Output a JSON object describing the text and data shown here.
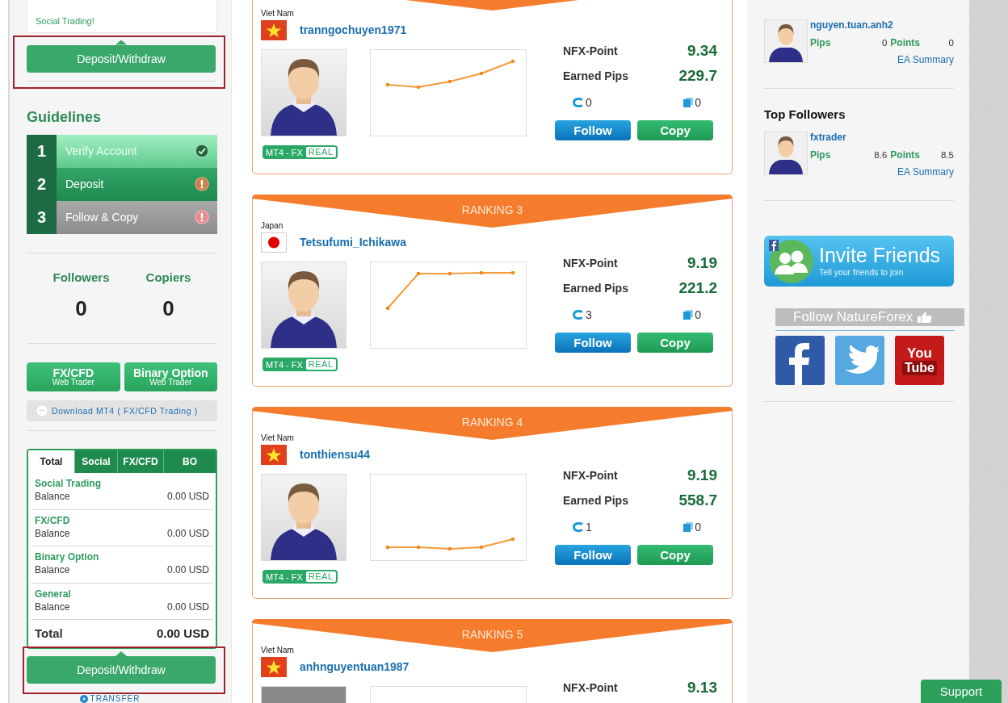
{
  "left_panel": {
    "intro_text": "Social Trading!",
    "top_deposit": {
      "label": "Deposit/Withdraw",
      "highlighted": true
    },
    "guidelines": {
      "title": "Guidelines",
      "steps": [
        {
          "number": "1",
          "label": "Verify Account",
          "kind": "done"
        },
        {
          "number": "2",
          "label": "Deposit",
          "kind": "current"
        },
        {
          "number": "3",
          "label": "Follow & Copy",
          "kind": "pending"
        }
      ]
    },
    "stats": [
      {
        "label": "Followers",
        "value": "0"
      },
      {
        "label": "Copiers",
        "value": "0"
      }
    ],
    "trader_buttons": [
      {
        "title": "FX/CFD",
        "subtitle": "Web Trader"
      },
      {
        "title": "Binary Option",
        "subtitle": "Web Trader"
      }
    ],
    "download_link": "Download MT4 ( FX/CFD Trading )",
    "balance": {
      "tabs": [
        {
          "label": "Total",
          "selected": true
        },
        {
          "label": "Social",
          "selected": false
        },
        {
          "label": "FX/CFD",
          "selected": false
        },
        {
          "label": "BO",
          "selected": false
        }
      ],
      "rows": [
        {
          "title": "Social Trading",
          "label": "Balance",
          "amount": "0.00 USD"
        },
        {
          "title": "FX/CFD",
          "label": "Balance",
          "amount": "0.00 USD"
        },
        {
          "title": "Binary Option",
          "label": "Balance",
          "amount": "0.00 USD"
        },
        {
          "title": "General",
          "label": "Balance",
          "amount": "0.00 USD"
        }
      ],
      "total_label": "Total",
      "total_amount": "0.00 USD"
    },
    "bottom_deposit": {
      "label": "Deposit/Withdraw",
      "highlighted": true
    },
    "transfer_link": "TRANSFER"
  },
  "rankings": [
    {
      "country": "Viet Nam",
      "flag": {
        "kind": "vn"
      },
      "name": "tranngochuyen1971",
      "avatar": {
        "kind": "silhouette"
      },
      "chart": {
        "kind": "rising"
      },
      "account_type": "MT4 - FX",
      "account_mode": "REAL",
      "nfx_label": "NFX-Point",
      "nfx_value": "9.34",
      "pips_label": "Earned Pips",
      "pips_value": "229.7",
      "followers": "0",
      "copiers": "0",
      "follow_label": "Follow",
      "copy_label": "Copy"
    },
    {
      "ranking": "RANKING 3",
      "country": "Japan",
      "flag": {
        "kind": "jp"
      },
      "name": "Tetsufumi_Ichikawa",
      "avatar": {
        "kind": "silhouette"
      },
      "chart": {
        "kind": "jump"
      },
      "account_type": "MT4 - FX",
      "account_mode": "REAL",
      "nfx_label": "NFX-Point",
      "nfx_value": "9.19",
      "pips_label": "Earned Pips",
      "pips_value": "221.2",
      "followers": "3",
      "copiers": "0",
      "follow_label": "Follow",
      "copy_label": "Copy"
    },
    {
      "ranking": "RANKING 4",
      "country": "Viet Nam",
      "flag": {
        "kind": "vn"
      },
      "name": "tonthiensu44",
      "avatar": {
        "kind": "silhouette"
      },
      "chart": {
        "kind": "flat_rise"
      },
      "account_type": "MT4 - FX",
      "account_mode": "REAL",
      "nfx_label": "NFX-Point",
      "nfx_value": "9.19",
      "pips_label": "Earned Pips",
      "pips_value": "558.7",
      "followers": "1",
      "copiers": "0",
      "follow_label": "Follow",
      "copy_label": "Copy"
    },
    {
      "ranking": "RANKING 5",
      "country": "Viet Nam",
      "flag": {
        "kind": "vn"
      },
      "name": "anhnguyentuan1987",
      "avatar": {
        "kind": "photo"
      },
      "nfx_label": "NFX-Point",
      "nfx_value": "9.13"
    }
  ],
  "right_panel": {
    "experts": [
      {
        "name": "nguyen.tuan.anh2",
        "pips_label": "Pips",
        "pips": "0",
        "points_label": "Points",
        "points": "0",
        "link": "EA Summary"
      }
    ],
    "top_followers": {
      "title": "Top Followers",
      "items": [
        {
          "name": "fxtrader",
          "pips_label": "Pips",
          "pips": "8.6",
          "points_label": "Points",
          "points": "8.5",
          "link": "EA Summary"
        }
      ]
    },
    "invite": {
      "title": "Invite Friends",
      "subtitle": "Tell your friends to join"
    },
    "follow_bar": "Follow NatureForex",
    "social": [
      {
        "kind": "facebook"
      },
      {
        "kind": "twitter"
      },
      {
        "kind": "youtube",
        "label_lines": [
          "You",
          "Tube"
        ]
      }
    ]
  },
  "support_button": "Support"
}
